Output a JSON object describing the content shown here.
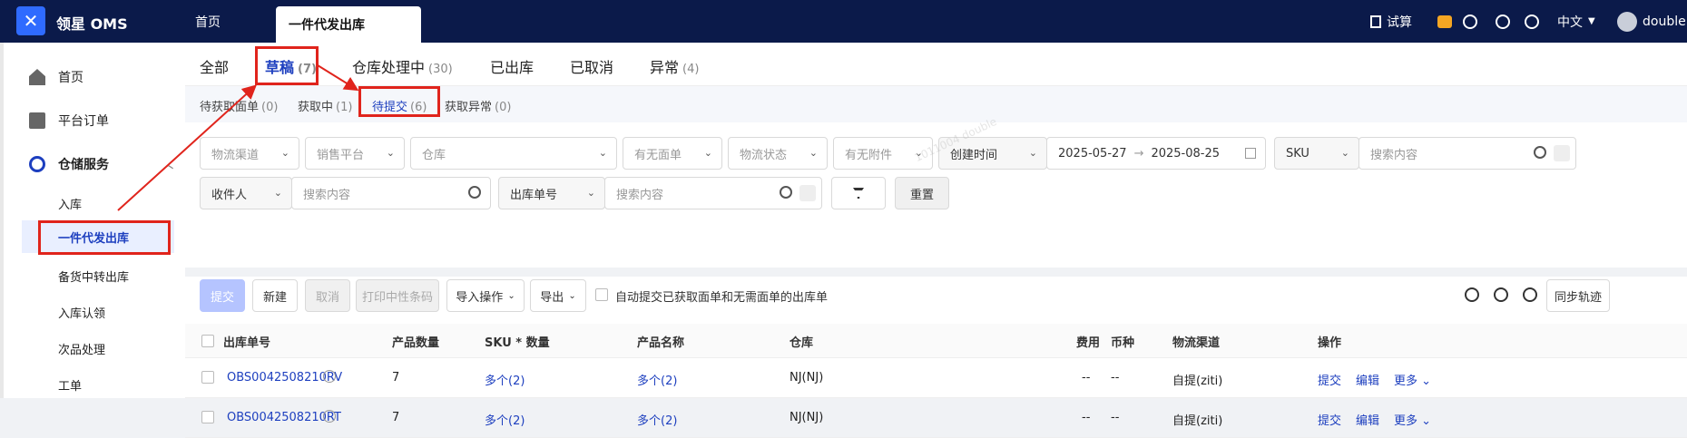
{
  "app": {
    "brand": "领星 OMS",
    "tabs": [
      {
        "label": "首页"
      },
      {
        "label": "一件代发出库"
      }
    ],
    "top_right": {
      "trial": "试算",
      "lang": "中文",
      "user": "double"
    }
  },
  "sidebar": {
    "items": [
      {
        "label": "首页"
      },
      {
        "label": "平台订单"
      },
      {
        "label": "仓储服务"
      }
    ],
    "sub_items": [
      {
        "label": "入库"
      },
      {
        "label": "一件代发出库"
      },
      {
        "label": "备货中转出库"
      },
      {
        "label": "入库认领"
      },
      {
        "label": "次品处理"
      },
      {
        "label": "工单"
      }
    ]
  },
  "status_tabs": [
    {
      "label": "全部",
      "count": ""
    },
    {
      "label": "草稿",
      "count": "(7)"
    },
    {
      "label": "仓库处理中",
      "count": "(30)"
    },
    {
      "label": "已出库",
      "count": ""
    },
    {
      "label": "已取消",
      "count": ""
    },
    {
      "label": "异常",
      "count": "(4)"
    }
  ],
  "sub_tabs": [
    {
      "label": "待获取面单",
      "count": "(0)"
    },
    {
      "label": "获取中",
      "count": "(1)"
    },
    {
      "label": "待提交",
      "count": "(6)"
    },
    {
      "label": "获取异常",
      "count": "(0)"
    }
  ],
  "filters": {
    "row1": [
      "物流渠道",
      "销售平台",
      "仓库",
      "有无面单",
      "物流状态",
      "有无附件"
    ],
    "time_type": "创建时间",
    "date_from": "2025-05-27",
    "date_arrow": "→",
    "date_to": "2025-08-25",
    "sku_type": "SKU",
    "search_placeholder": "搜索内容",
    "receiver_type": "收件人",
    "order_type": "出库单号",
    "reset": "重置"
  },
  "toolbar": {
    "submit": "提交",
    "create": "新建",
    "cancel": "取消",
    "print": "打印中性条码",
    "import": "导入操作",
    "export": "导出",
    "auto_submit": "自动提交已获取面单和无需面单的出库单",
    "sync": "同步轨迹"
  },
  "table": {
    "headers": [
      "出库单号",
      "产品数量",
      "SKU * 数量",
      "产品名称",
      "仓库",
      "费用",
      "币种",
      "物流渠道",
      "操作"
    ],
    "rows": [
      {
        "order": "OBS0042508210RV",
        "qty": "7",
        "sku": "多个(2)",
        "name": "多个(2)",
        "warehouse": "NJ(NJ)",
        "fee": "--",
        "currency": "--",
        "channel": "自提(ziti)",
        "op1": "提交",
        "op2": "编辑",
        "op3": "更多"
      },
      {
        "order": "OBS0042508210RT",
        "qty": "7",
        "sku": "多个(2)",
        "name": "多个(2)",
        "warehouse": "NJ(NJ)",
        "fee": "--",
        "currency": "--",
        "channel": "自提(ziti)",
        "op1": "提交",
        "op2": "编辑",
        "op3": "更多"
      }
    ]
  },
  "watermark": "1011004 double",
  "colors": {
    "topbar": "#0b1a4a",
    "accent": "#1d3fbf",
    "annotation": "#e0241c"
  }
}
